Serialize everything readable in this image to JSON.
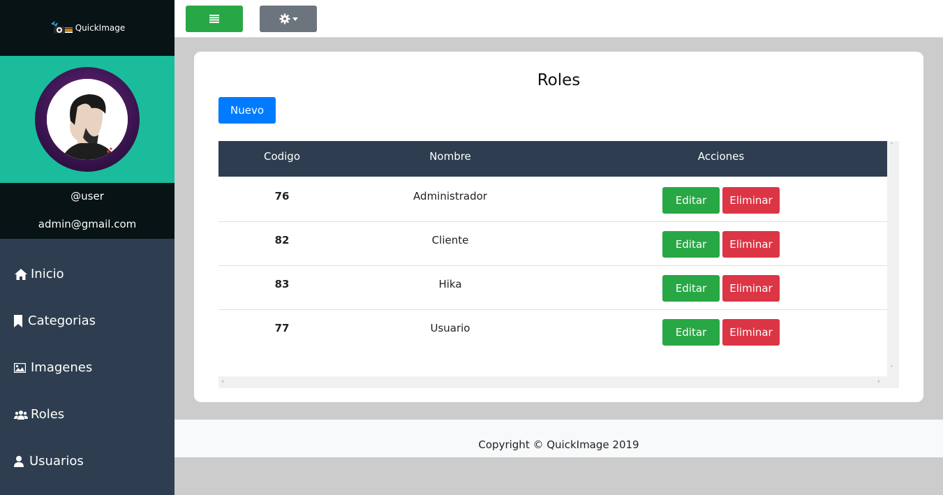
{
  "brand": {
    "name": "QuickImage"
  },
  "profile": {
    "username": "@user",
    "email": "admin@gmail.com"
  },
  "sidebar": {
    "items": [
      {
        "label": "Inicio",
        "icon": "home-icon"
      },
      {
        "label": "Categorias",
        "icon": "bookmark-icon"
      },
      {
        "label": "Imagenes",
        "icon": "image-icon"
      },
      {
        "label": "Roles",
        "icon": "users-icon"
      },
      {
        "label": "Usuarios",
        "icon": "user-icon"
      }
    ]
  },
  "topbar": {
    "menu_icon": "list-icon",
    "settings_icon": "gear-icon"
  },
  "main": {
    "title": "Roles",
    "new_label": "Nuevo",
    "table": {
      "headers": [
        "Codigo",
        "Nombre",
        "Acciones"
      ],
      "rows": [
        {
          "code": "76",
          "name": "Administrador"
        },
        {
          "code": "82",
          "name": "Cliente"
        },
        {
          "code": "83",
          "name": "Hika"
        },
        {
          "code": "77",
          "name": "Usuario"
        }
      ],
      "edit_label": "Editar",
      "delete_label": "Eliminar"
    }
  },
  "footer": {
    "text": "Copyright © QuickImage 2019"
  },
  "colors": {
    "sidebar": "#2e3e50",
    "profile_bg": "#1abc9c",
    "success": "#28a745",
    "danger": "#dc3545",
    "primary": "#007bff",
    "secondary": "#6c757d"
  }
}
